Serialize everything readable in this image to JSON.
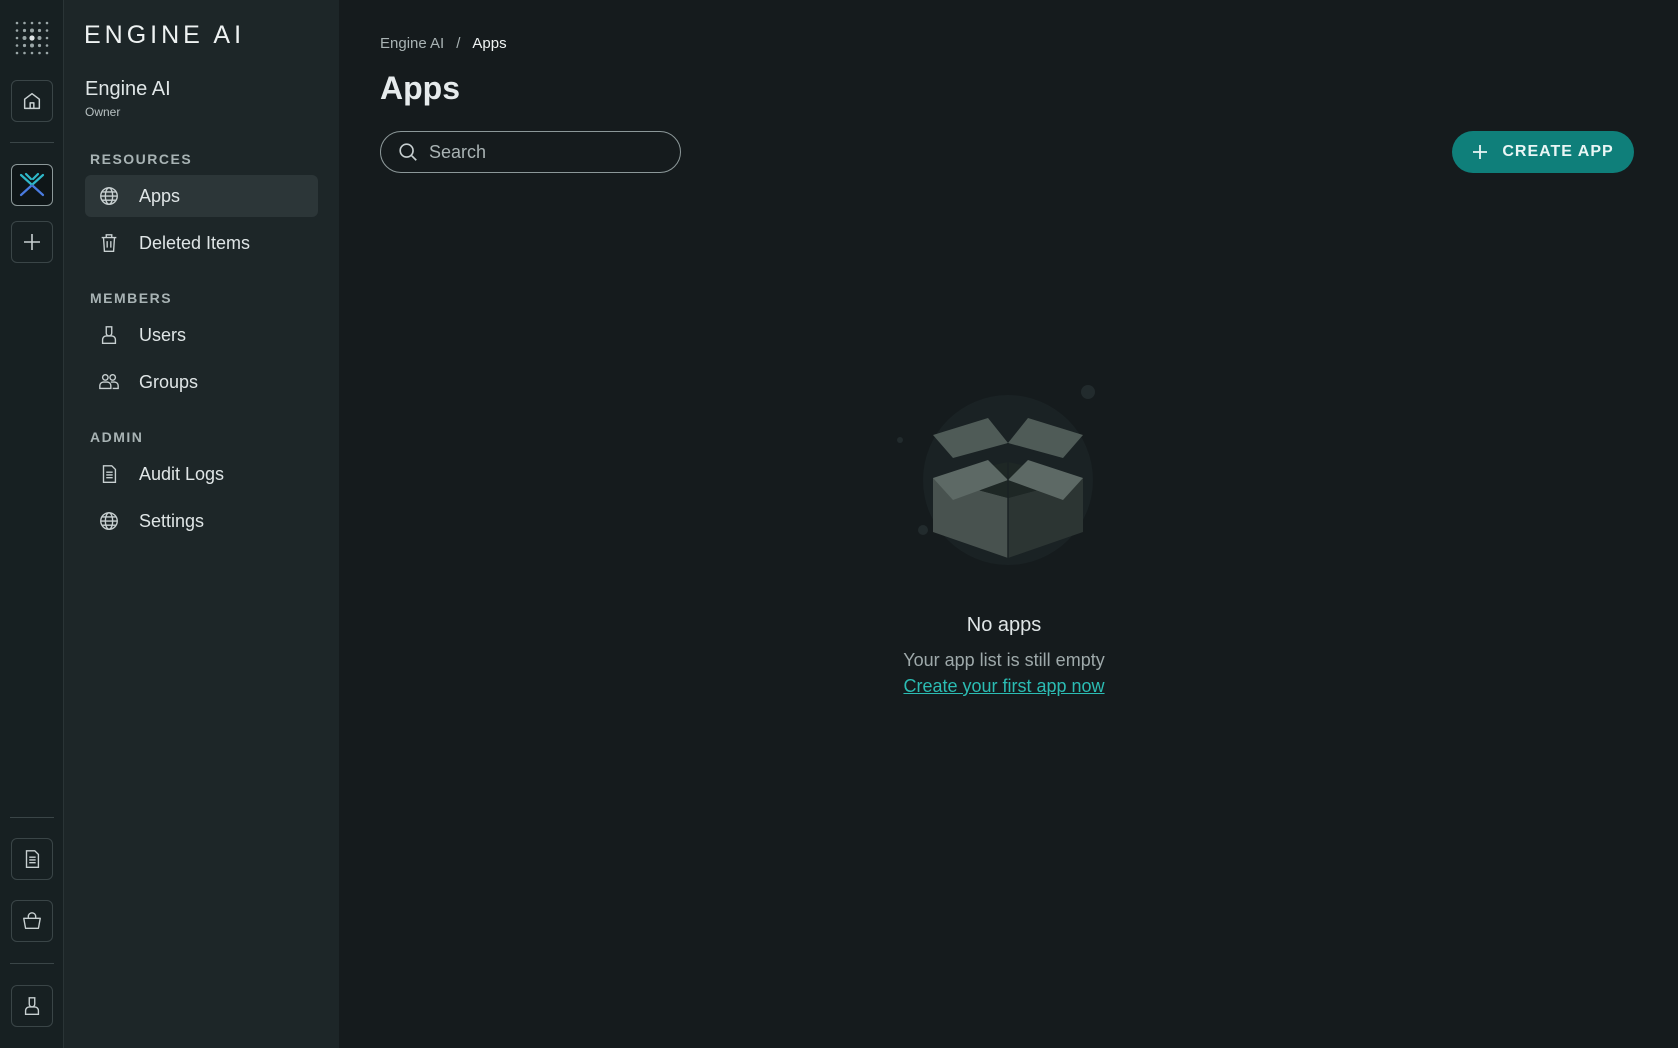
{
  "brand": {
    "name": "ENGINE AI"
  },
  "organization": {
    "name": "Engine AI",
    "role": "Owner"
  },
  "sidebar": {
    "sections": [
      {
        "title": "RESOURCES",
        "items": [
          {
            "label": "Apps",
            "icon": "globe-icon",
            "active": true
          },
          {
            "label": "Deleted Items",
            "icon": "trash-icon"
          }
        ]
      },
      {
        "title": "MEMBERS",
        "items": [
          {
            "label": "Users",
            "icon": "user-icon"
          },
          {
            "label": "Groups",
            "icon": "group-icon"
          }
        ]
      },
      {
        "title": "ADMIN",
        "items": [
          {
            "label": "Audit Logs",
            "icon": "document-icon"
          },
          {
            "label": "Settings",
            "icon": "globe-icon"
          }
        ]
      }
    ]
  },
  "rail": {
    "icons": [
      "dots-grid-icon",
      "home-icon",
      "engine-ai-logo-icon",
      "plus-icon",
      "document-icon",
      "bag-icon",
      "user-icon"
    ]
  },
  "breadcrumb": {
    "root": "Engine AI",
    "separator": "/",
    "current": "Apps"
  },
  "page": {
    "title": "Apps"
  },
  "search": {
    "placeholder": "Search",
    "value": ""
  },
  "actions": {
    "create_label": "CREATE APP"
  },
  "empty_state": {
    "title": "No apps",
    "subtitle": "Your app list is still empty",
    "link": "Create your first app now"
  },
  "colors": {
    "accent": "#0f7f7a",
    "link": "#2bbcb3",
    "background": "#151b1d",
    "sidebar": "#1d2628"
  }
}
